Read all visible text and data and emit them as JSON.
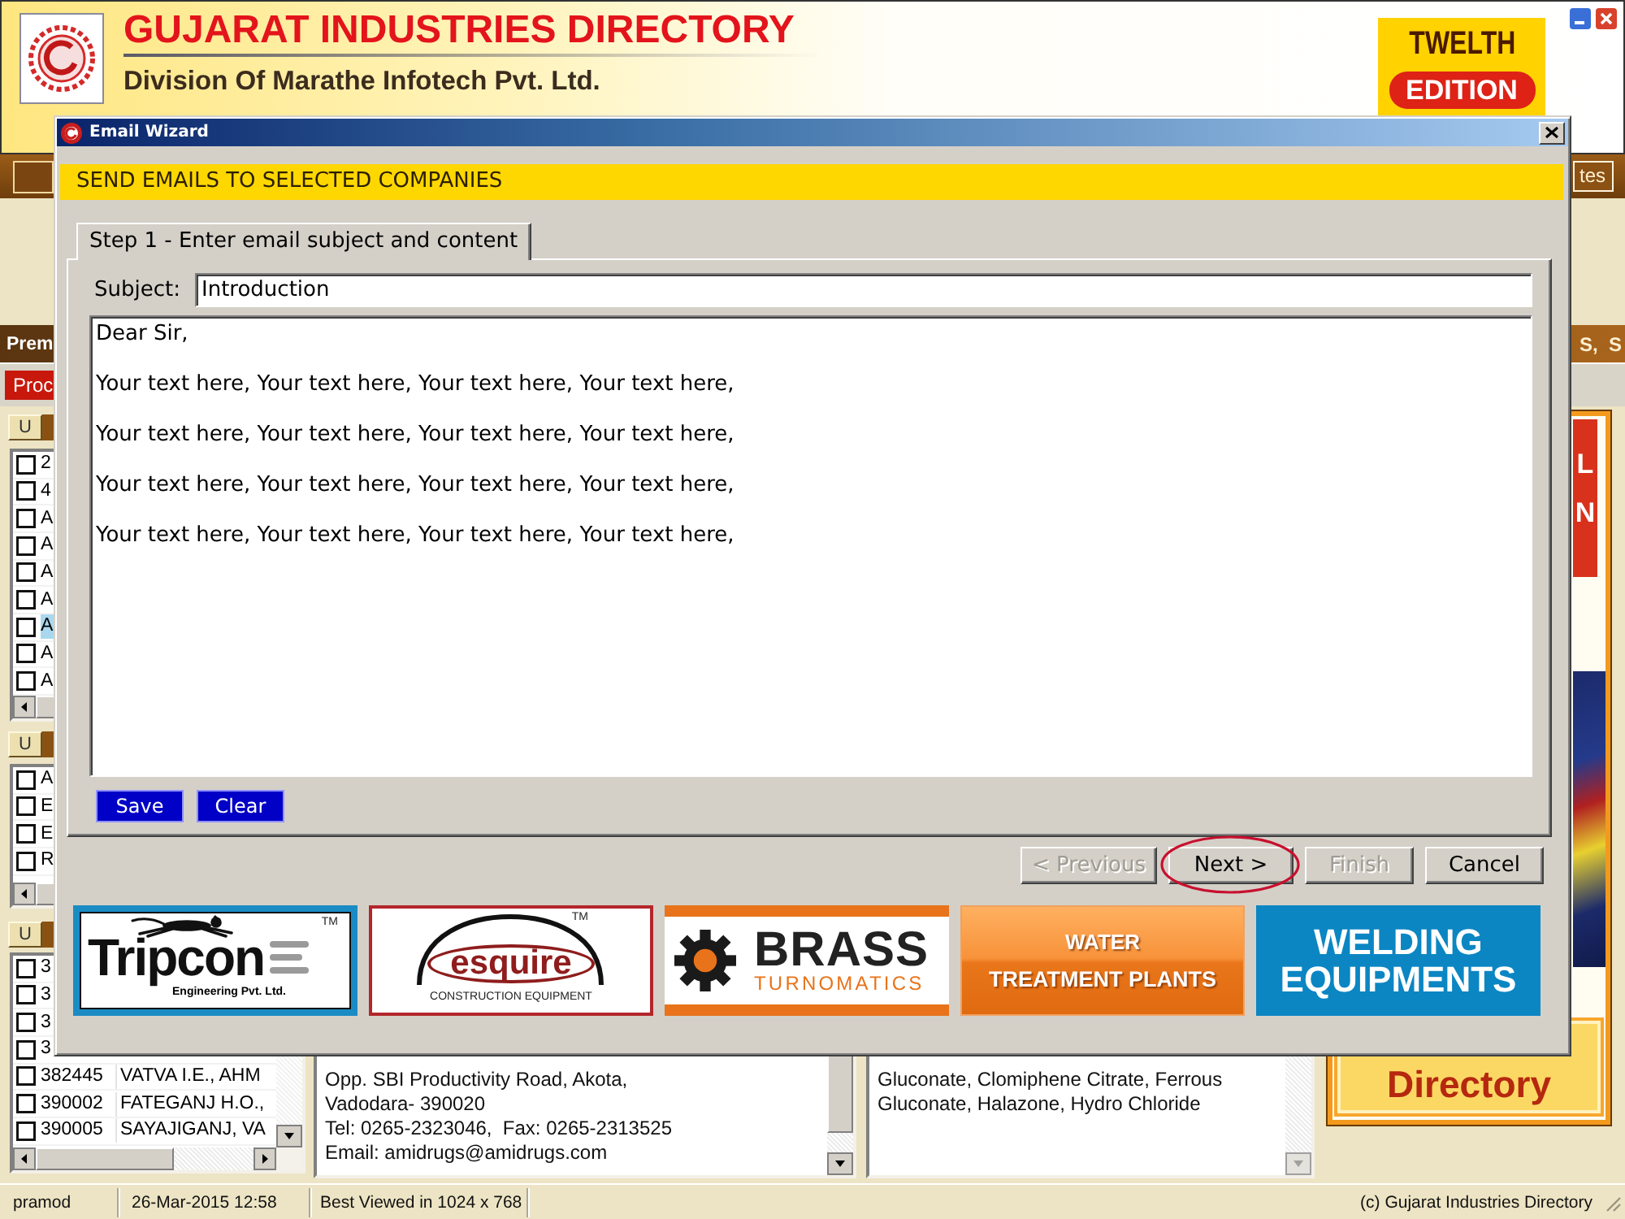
{
  "app": {
    "title": "GUJARAT INDUSTRIES DIRECTORY",
    "subtitle": "Division Of Marathe Infotech Pvt. Ltd.",
    "badge": {
      "line_1": "TWELTH",
      "line_2": "EDITION"
    }
  },
  "toolbar": {
    "right_button": "tes"
  },
  "section_bar": {
    "left_label": "Prem",
    "right_label": "S,  S"
  },
  "tab_strip": {
    "tabs": [
      {
        "label": "Proc",
        "selected": true
      }
    ]
  },
  "lists": [
    {
      "button": "U",
      "rows": [
        {
          "cells": [
            "2"
          ],
          "checked": false,
          "selected": false
        },
        {
          "cells": [
            "4"
          ],
          "checked": false,
          "selected": false
        },
        {
          "cells": [
            "A"
          ],
          "checked": false,
          "selected": false
        },
        {
          "cells": [
            "A"
          ],
          "checked": false,
          "selected": false
        },
        {
          "cells": [
            "A"
          ],
          "checked": false,
          "selected": false
        },
        {
          "cells": [
            "A"
          ],
          "checked": false,
          "selected": false
        },
        {
          "cells": [
            "A"
          ],
          "checked": false,
          "selected": true
        },
        {
          "cells": [
            "A"
          ],
          "checked": false,
          "selected": false
        },
        {
          "cells": [
            "A"
          ],
          "checked": false,
          "selected": false
        }
      ]
    },
    {
      "button": "U",
      "rows": [
        {
          "cells": [
            "A"
          ],
          "checked": false,
          "selected": false
        },
        {
          "cells": [
            "E"
          ],
          "checked": false,
          "selected": false
        },
        {
          "cells": [
            "E"
          ],
          "checked": false,
          "selected": false
        },
        {
          "cells": [
            "R"
          ],
          "checked": false,
          "selected": false
        }
      ]
    },
    {
      "button": "U",
      "rows": [
        {
          "cells": [
            "3"
          ],
          "checked": false,
          "selected": false
        },
        {
          "cells": [
            "3"
          ],
          "checked": false,
          "selected": false
        },
        {
          "cells": [
            "3"
          ],
          "checked": false,
          "selected": false
        },
        {
          "cells": [
            "3"
          ],
          "checked": false,
          "selected": false
        },
        {
          "cells": [
            "382445",
            "VATVA I.E., AHM"
          ],
          "checked": false,
          "selected": false
        },
        {
          "cells": [
            "390002",
            "FATEGANJ H.O.,"
          ],
          "checked": false,
          "selected": false
        },
        {
          "cells": [
            "390005",
            "SAYAJIGANJ, VA"
          ],
          "checked": false,
          "selected": false
        }
      ]
    }
  ],
  "address_pane": {
    "lines": [
      "Opp. SBI Productivity Road, Akota,",
      "Vadodara- 390020",
      "Tel: 0265-2323046,  Fax: 0265-2313525",
      "Email: amidrugs@amidrugs.com"
    ]
  },
  "products_pane": {
    "lines": [
      "Gluconate, Clomiphene Citrate, Ferrous",
      "Gluconate, Halazone, Hydro Chloride"
    ]
  },
  "ad_panel": {
    "letters": [
      "L",
      "N"
    ],
    "caption": "Directory"
  },
  "dialog": {
    "title": "Email Wizard",
    "banner": "SEND EMAILS TO SELECTED COMPANIES",
    "tabs": [
      {
        "label": "Step 1 - Enter email subject and content",
        "selected": true
      }
    ],
    "subject": {
      "label": "Subject:",
      "value": "Introduction"
    },
    "body": "Dear Sir,\n\nYour text here, Your text here, Your text here, Your text here,\n\nYour text here, Your text here, Your text here, Your text here,\n\nYour text here, Your text here, Your text here, Your text here,\n\nYour text here, Your text here, Your text here, Your text here,",
    "actions": [
      "Save",
      "Clear"
    ],
    "nav_buttons": [
      {
        "label": "< Previous",
        "disabled": true,
        "highlighted": false
      },
      {
        "label": "Next >",
        "disabled": false,
        "highlighted": true
      },
      {
        "label": "Finish",
        "disabled": true,
        "highlighted": false
      },
      {
        "label": "Cancel",
        "disabled": false,
        "highlighted": false
      }
    ],
    "ads": [
      {
        "kind": "tripcone",
        "line_1": "Tripcon",
        "line_2": "Engineering Pvt. Ltd.",
        "mark": "TM"
      },
      {
        "kind": "esquire",
        "line_1": "esquire",
        "line_2": "CONSTRUCTION EQUIPMENT",
        "mark": "TM"
      },
      {
        "kind": "brass",
        "line_1": "BRASS",
        "line_2": "TURNOMATICS"
      },
      {
        "kind": "water",
        "line_1": "WATER",
        "line_2": "TREATMENT PLANTS"
      },
      {
        "kind": "welding",
        "line_1": "WELDING",
        "line_2": "EQUIPMENTS"
      }
    ]
  },
  "status_bar": {
    "cells": [
      "pramod",
      "26-Mar-2015 12:58",
      "Best Viewed in 1024 x 768"
    ],
    "copyright": "(c) Gujarat Industries Directory"
  }
}
